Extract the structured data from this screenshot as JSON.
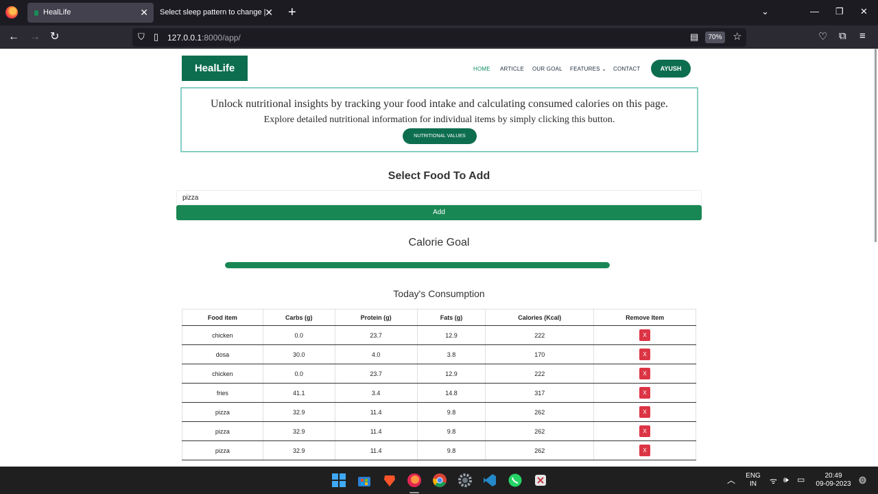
{
  "browser": {
    "tabs": [
      {
        "title": "HealLife",
        "active": true
      },
      {
        "title": "Select sleep pattern to change | Dja",
        "active": false
      }
    ],
    "url_host": "127.0.0.1",
    "url_rest": ":8000/app/",
    "zoom": "70%"
  },
  "site": {
    "brand": "HealLife",
    "nav": [
      "HOME",
      "ARTICLE",
      "OUR GOAL",
      "FEATURES",
      "CONTACT"
    ],
    "user": "AYUSH"
  },
  "info": {
    "line1": "Unlock nutritional insights by tracking your food intake and calculating consumed calories on this page.",
    "line2": "Explore detailed nutritional information for individual items by simply clicking this button.",
    "button": "NUTRITIONAL VALUES"
  },
  "add_food": {
    "heading": "Select Food To Add",
    "value": "pizza",
    "button": "Add"
  },
  "goal": {
    "heading": "Calorie Goal",
    "progress": 1.0
  },
  "consumption": {
    "heading": "Today's Consumption",
    "columns": [
      "Food item",
      "Carbs (g)",
      "Protein (g)",
      "Fats (g)",
      "Calories (Kcal)",
      "Remove Item"
    ],
    "remove_label": "X",
    "rows": [
      [
        "chicken",
        "0.0",
        "23.7",
        "12.9",
        "222"
      ],
      [
        "dosa",
        "30.0",
        "4.0",
        "3.8",
        "170"
      ],
      [
        "chicken",
        "0.0",
        "23.7",
        "12.9",
        "222"
      ],
      [
        "fries",
        "41.1",
        "3.4",
        "14.8",
        "317"
      ],
      [
        "pizza",
        "32.9",
        "11.4",
        "9.8",
        "262"
      ],
      [
        "pizza",
        "32.9",
        "11.4",
        "9.8",
        "262"
      ],
      [
        "pizza",
        "32.9",
        "11.4",
        "9.8",
        "262"
      ]
    ]
  },
  "taskbar": {
    "lang1": "ENG",
    "lang2": "IN",
    "time": "20:49",
    "date": "09-09-2023"
  },
  "colors": {
    "brand": "#0d6e4f",
    "success": "#198754",
    "danger": "#dc3545"
  }
}
